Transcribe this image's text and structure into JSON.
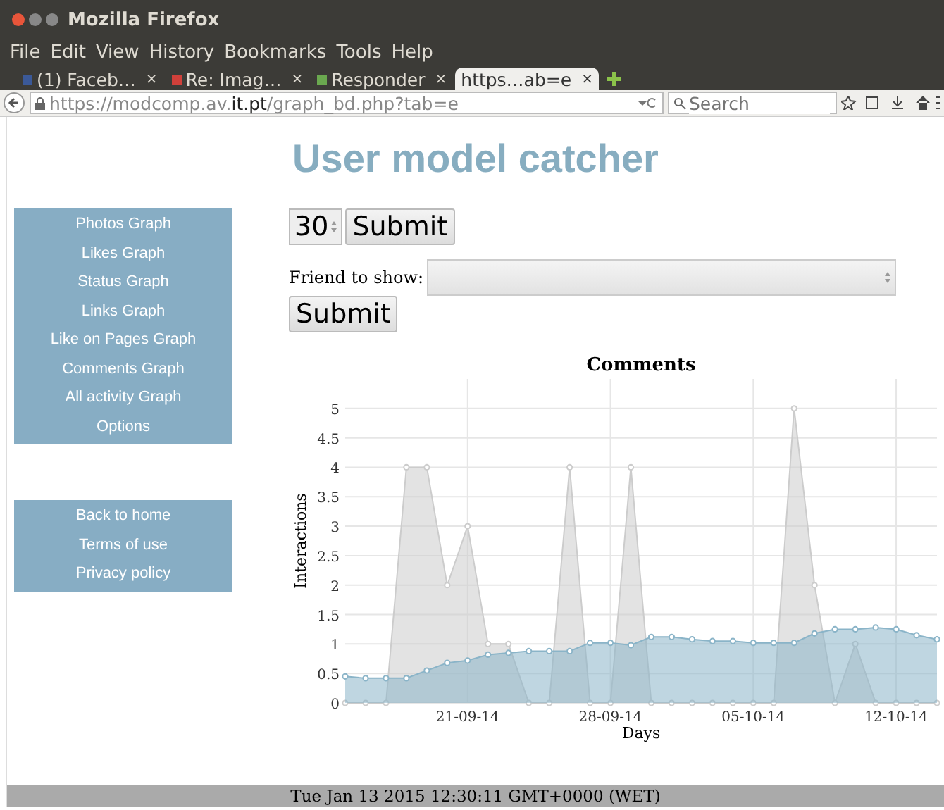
{
  "window": {
    "title": "Mozilla Firefox"
  },
  "menu": [
    "File",
    "Edit",
    "View",
    "History",
    "Bookmarks",
    "Tools",
    "Help"
  ],
  "tabs": [
    {
      "label": "(1) Faceb…",
      "close": "×",
      "selected": false,
      "color": "#3b5998"
    },
    {
      "label": "Re: Imag…",
      "close": "×",
      "selected": false,
      "color": "#d0403a"
    },
    {
      "label": "Responder",
      "close": "×",
      "selected": false,
      "color": "#6aa84f"
    },
    {
      "label": "https…ab=e",
      "close": "×",
      "selected": true
    }
  ],
  "address": {
    "prefix": "https://modcomp.av.",
    "host": "it.pt",
    "path": "/graph_bd.php?tab=e"
  },
  "search": {
    "placeholder": "Search"
  },
  "page": {
    "heading": "User model catcher",
    "nav": [
      "Photos Graph",
      "Likes Graph",
      "Status Graph",
      "Links Graph",
      "Like on Pages Graph",
      "Comments Graph",
      "All activity Graph",
      "Options"
    ],
    "links": [
      "Back to home",
      "Terms of use",
      "Privacy policy"
    ],
    "days": {
      "value": "30"
    },
    "submit": "Submit",
    "friend_label": "Friend to show:",
    "submit2": "Submit",
    "chart_data": {
      "type": "area",
      "title": "Comments",
      "xlabel": "Days",
      "ylabel": "Interactions",
      "categories": [
        null,
        null,
        null,
        null,
        null,
        null,
        "21-09-14",
        null,
        null,
        null,
        null,
        null,
        null,
        "28-09-14",
        null,
        null,
        null,
        null,
        null,
        null,
        "05-10-14",
        null,
        null,
        null,
        null,
        null,
        null,
        "12-10-14",
        null,
        null
      ],
      "series": [
        {
          "color": "#cccccc",
          "values": [
            0,
            0,
            0,
            4,
            4,
            2,
            3,
            1,
            1,
            0,
            0,
            4,
            0,
            0,
            4,
            0,
            0,
            0,
            0,
            0,
            0,
            0,
            5,
            2,
            0,
            1,
            0,
            0,
            0,
            0
          ]
        },
        {
          "color": "#8ab4c8",
          "values": [
            0.45,
            0.42,
            0.42,
            0.42,
            0.55,
            0.68,
            0.72,
            0.82,
            0.85,
            0.88,
            0.88,
            0.88,
            1.02,
            1.02,
            0.98,
            1.12,
            1.12,
            1.08,
            1.05,
            1.05,
            1.02,
            1.02,
            1.02,
            1.18,
            1.25,
            1.25,
            1.28,
            1.25,
            1.15,
            1.08
          ]
        }
      ],
      "ylim": [
        0,
        5.5
      ],
      "grid": true,
      "yticks": [
        0,
        0.5,
        1,
        1.5,
        2,
        2.5,
        3,
        3.5,
        4,
        4.5,
        5
      ]
    },
    "footer": "Tue Jan 13 2015 12:30:11 GMT+0000 (WET)"
  }
}
